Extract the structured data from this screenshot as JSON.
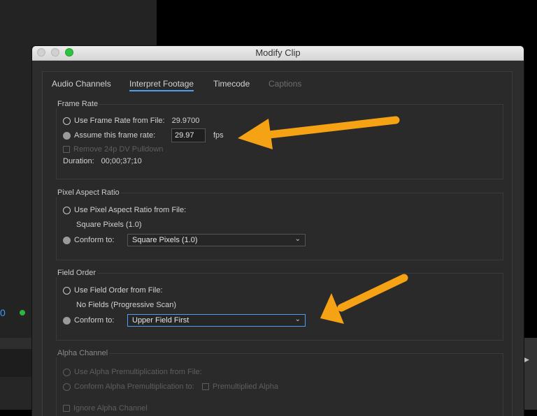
{
  "window": {
    "title": "Modify Clip"
  },
  "tabs": [
    {
      "label": "Audio Channels"
    },
    {
      "label": "Interpret Footage"
    },
    {
      "label": "Timecode"
    },
    {
      "label": "Captions"
    }
  ],
  "frame_rate": {
    "title": "Frame Rate",
    "use_file_label": "Use Frame Rate from File:",
    "file_rate": "29.9700",
    "assume_label": "Assume this frame rate:",
    "assume_value": "29.97",
    "fps_label": "fps",
    "remove_pulldown_label": "Remove 24p DV Pulldown",
    "duration_label": "Duration:",
    "duration_value": "00;00;37;10"
  },
  "pixel_aspect": {
    "title": "Pixel Aspect Ratio",
    "use_file_label": "Use Pixel Aspect Ratio from File:",
    "file_value": "Square Pixels (1.0)",
    "conform_label": "Conform to:",
    "conform_value": "Square Pixels (1.0)"
  },
  "field_order": {
    "title": "Field Order",
    "use_file_label": "Use Field Order from File:",
    "file_value": "No Fields (Progressive Scan)",
    "conform_label": "Conform to:",
    "conform_value": "Upper Field First"
  },
  "alpha": {
    "title": "Alpha Channel",
    "use_file_label": "Use Alpha Premultiplication from File:",
    "conform_label": "Conform Alpha Premultiplication to:",
    "premult_label": "Premultiplied Alpha",
    "ignore_label": "Ignore Alpha Channel"
  },
  "background": {
    "readout": "0"
  },
  "colors": {
    "accent": "#4b9ef0",
    "annotation_arrow": "#f5a314"
  }
}
